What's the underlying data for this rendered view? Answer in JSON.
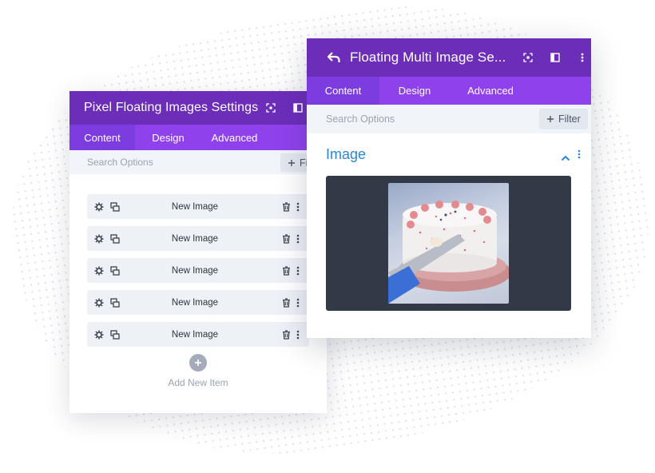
{
  "back_panel": {
    "title": "Pixel Floating Images Settings",
    "tabs": [
      {
        "label": "Content",
        "active": true
      },
      {
        "label": "Design",
        "active": false
      },
      {
        "label": "Advanced",
        "active": false
      }
    ],
    "search_placeholder": "Search Options",
    "filter_label": "Fil",
    "items": [
      {
        "label": "New Image"
      },
      {
        "label": "New Image"
      },
      {
        "label": "New Image"
      },
      {
        "label": "New Image"
      },
      {
        "label": "New Image"
      }
    ],
    "add_label": "Add New Item"
  },
  "front_panel": {
    "title": "Floating Multi Image Se...",
    "tabs": [
      {
        "label": "Content",
        "active": true
      },
      {
        "label": "Design",
        "active": false
      },
      {
        "label": "Advanced",
        "active": false
      }
    ],
    "search_placeholder": "Search Options",
    "filter_label": "Filter",
    "section_title": "Image"
  },
  "colors": {
    "header": "#6c2eb9",
    "tabs": "#8f42ec",
    "active_tab": "#7d3ce0",
    "accent": "#2b87da",
    "image_bg": "#323a47"
  },
  "icons": [
    "back-arrow-icon",
    "focus-icon",
    "sidebar-icon",
    "more-icon",
    "gear-icon",
    "duplicate-icon",
    "trash-icon",
    "plus-icon",
    "chevron-up-icon"
  ]
}
